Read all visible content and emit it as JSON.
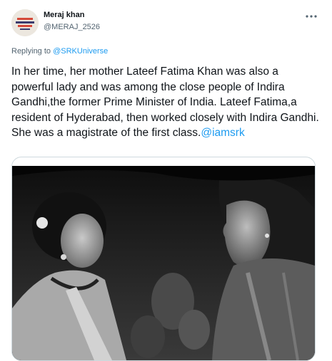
{
  "author": {
    "name": "Meraj khan",
    "handle": "@MERAJ_2526"
  },
  "reply": {
    "prefix": "Replying to",
    "mention": "@SRKUniverse"
  },
  "tweet": {
    "text": "In her time, her mother Lateef Fatima Khan was also a powerful lady and was among the close people of Indira Gandhi,the former Prime Minister of India. Lateef Fatima,a resident of Hyderabad, then worked closely with Indira Gandhi. She was a magistrate of the first class.",
    "hashtag_link": "@iamsrk"
  },
  "icons": {
    "more": "more-horizontal-icon",
    "avatar": "avatar-image"
  },
  "colors": {
    "link": "#1d9bf0",
    "secondary_text": "#536471",
    "border": "#cfd9de"
  }
}
